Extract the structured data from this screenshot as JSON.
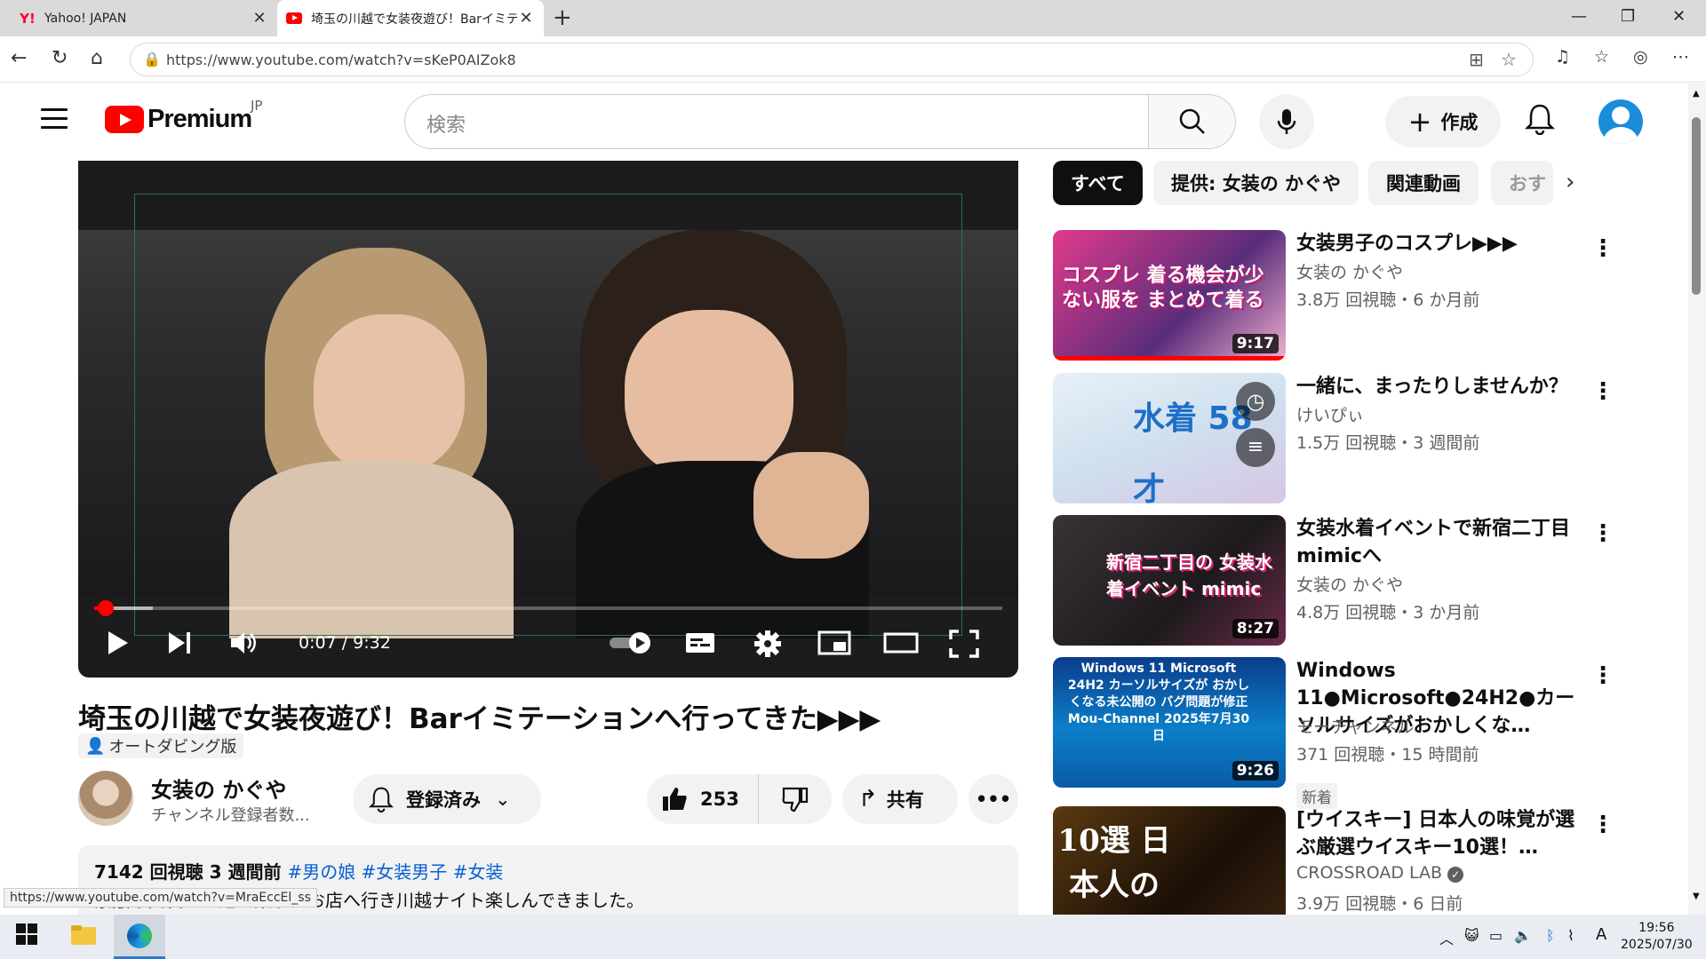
{
  "browser": {
    "tabs": [
      {
        "title": "Yahoo! JAPAN"
      },
      {
        "title": "埼玉の川越で女装夜遊び！Barイミテ"
      }
    ],
    "url": "https://www.youtube.com/watch?v=sKeP0AIZok8",
    "status_url": "https://www.youtube.com/watch?v=MraEccEl_ss"
  },
  "youtube": {
    "logo_word": "Premium",
    "logo_region": "JP",
    "search_placeholder": "検索",
    "create_label": "作成"
  },
  "player": {
    "time": "0:07 / 9:32",
    "progress_fraction": 0.012
  },
  "video": {
    "title": "埼玉の川越で女装夜遊び！Barイミテーションへ行ってきた▶▶▶",
    "dubbing": "オートダビング版",
    "channel": "女装の かぐや",
    "subscribers": "チャンネル登録者数...",
    "subscribe_label": "登録済み",
    "likes": "253",
    "share_label": "共有",
    "views_age": "7142 回視聴  3 週間前",
    "hashtags": "#男の娘 #女装男子 #女装",
    "desc_line": "素敵な女装さん達が集まるお店へ行き川越ナイト楽しんできました。"
  },
  "chips": [
    "すべて",
    "提供: 女装の かぐや",
    "関連動画",
    "おす"
  ],
  "related": [
    {
      "title": "女装男子のコスプレ▶▶▶",
      "channel": "女装の かぐや",
      "meta": "3.8万 回視聴・6 か月前",
      "duration": "9:17",
      "thumb_text": "コスプレ 着る機会が少ない服を まとめて着る",
      "watched_fraction": 1.0
    },
    {
      "title": "一緒に、まったりしませんか？",
      "channel": "けいぴぃ",
      "meta": "1.5万 回視聴・3 週間前",
      "duration": "",
      "thumb_text": "水着 58才",
      "watched_fraction": 0
    },
    {
      "title": "女装水着イベントで新宿二丁目mimicへ",
      "channel": "女装の かぐや",
      "meta": "4.8万 回視聴・3 か月前",
      "duration": "8:27",
      "thumb_text": "新宿二丁目の 女装水着イベント mimic",
      "watched_fraction": 0
    },
    {
      "title": "Windows 11●Microsoft●24H2●カーソルサイズがおかしくな…",
      "channel": "モーチャンネル",
      "meta": "371 回視聴・15 時間前",
      "duration": "9:26",
      "badge": "新着",
      "thumb_text": "Windows 11 Microsoft 24H2 カーソルサイズが おかしくなる未公開の バグ問題が修正 Mou-Channel 2025年7月30日",
      "watched_fraction": 0
    },
    {
      "title": "[ウイスキー] 日本人の味覚が選ぶ厳選ウイスキー10選！…",
      "channel": "CROSSROAD LAB",
      "meta": "3.9万 回視聴・6 日前",
      "duration": "",
      "thumb_text": "10選 日本人の",
      "watched_fraction": 0
    }
  ],
  "taskbar": {
    "time": "19:56",
    "date": "2025/07/30",
    "ime": "A"
  },
  "colors": {
    "youtube_red": "#ff0000",
    "link_blue": "#065fd4",
    "chip_active": "#0f0f0f"
  }
}
